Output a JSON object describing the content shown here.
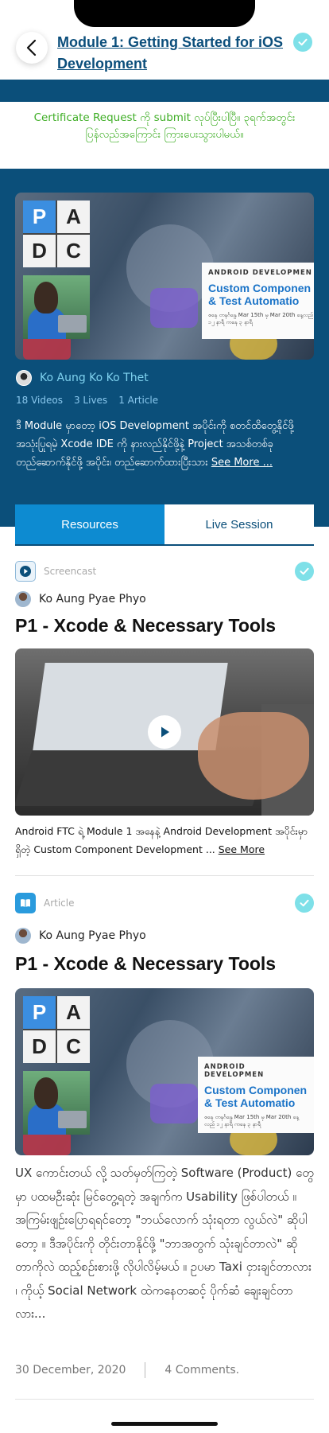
{
  "header": {
    "title": "Module 1: Getting Started for iOS Development"
  },
  "certificate_notice": "Certificate Request ကို submit လုပ်ပြီးပါပြီ။ ၃ရက်အတွင်း ပြန်လည်အကြောင်း ကြားပေးသွားပါမယ်။",
  "course": {
    "banner": {
      "logo_letters": [
        "P",
        "A",
        "D",
        "C"
      ],
      "card_top": "ANDROID DEVELOPMEN",
      "card_title": "Custom Componen & Test Automatio",
      "card_dates": "စနေ တနင်္ဂနွေ Mar 15th မှ Mar 20th နေ့လည် ၁၂ နာရီ ကနေ ၃ နာရီ"
    },
    "instructor": "Ko Aung Ko Ko Thet",
    "stats": [
      "18 Videos",
      "3 Lives",
      "1 Article"
    ],
    "description": "ဒီ Module မှာတော့ iOS Development အပိုင်းကို စတင်ထိတွေ့နိုင်ဖို့ အသုံးပြုရမဲ့ Xcode IDE ကို နားလည်နိုင်ဖို့နဲ့ Project အသစ်တစ်ခု တည်ဆောက်နိုင်ဖို့ အပိုင်း၊ တည်ဆောက်ထားပြီးသား ",
    "see_more": "See More ..."
  },
  "tabs": [
    {
      "label": "Resources",
      "active": true
    },
    {
      "label": "Live Session",
      "active": false
    }
  ],
  "items": [
    {
      "type": "Screencast",
      "type_icon": "play-icon",
      "author": "Ko Aung Pyae Phyo",
      "title": "P1 - Xcode & Necessary Tools",
      "description": "Android FTC ရဲ့ Module 1 အနေနဲ့ Android Development အပိုင်းမှာ ရှိတဲ့ Custom Component Development ... ",
      "see_more": "See More",
      "completed": true
    },
    {
      "type": "Article",
      "type_icon": "book-icon",
      "author": "Ko Aung Pyae Phyo",
      "title": "P1 - Xcode & Necessary Tools",
      "banner": {
        "logo_letters": [
          "P",
          "A",
          "D",
          "C"
        ],
        "card_top": "ANDROID DEVELOPMEN",
        "card_title": "Custom Componen & Test Automatio",
        "card_dates": "စနေ တနင်္ဂနွေ Mar 15th မှ Mar 20th နေ့လည် ၁၂ နာရီ ကနေ ၃ နာရီ"
      },
      "body": "UX ကောင်းတယ် လို့ သတ်မှတ်ကြတဲ့ Software (Product) တွေမှာ ပထမဦးဆုံး မြင်တွေ့ရတဲ့ အချက်က Usability ဖြစ်ပါတယ် ။ အကြမ်းဖျဉ်းပြောရရင်တော့ \"ဘယ်လောက် သုံးရတာ လွယ်လဲ\" ဆိုပါတော့ ။ ဒီအပိုင်းကို တိုင်းတာနိုင်ဖို့ \"ဘာအတွက် သုံးချင်တာလဲ\" ဆိုတာကိုလဲ ထည့်စဉ်းစားဖို့ လိုပါလိမ့်မယ် ။ ဥပမာ Taxi ငှားချင်တာလား ၊ ကိုယ့် Social Network ထဲကနေတဆင့် ပိုက်ဆံ ချေးချင်တာလား...",
      "date": "30 December, 2020",
      "comments": "4 Comments.",
      "completed": true
    }
  ],
  "colors": {
    "primary": "#0b4f7a",
    "accent": "#0d8bd1",
    "check": "#7ee0e8",
    "notice_green": "#3fae26"
  }
}
